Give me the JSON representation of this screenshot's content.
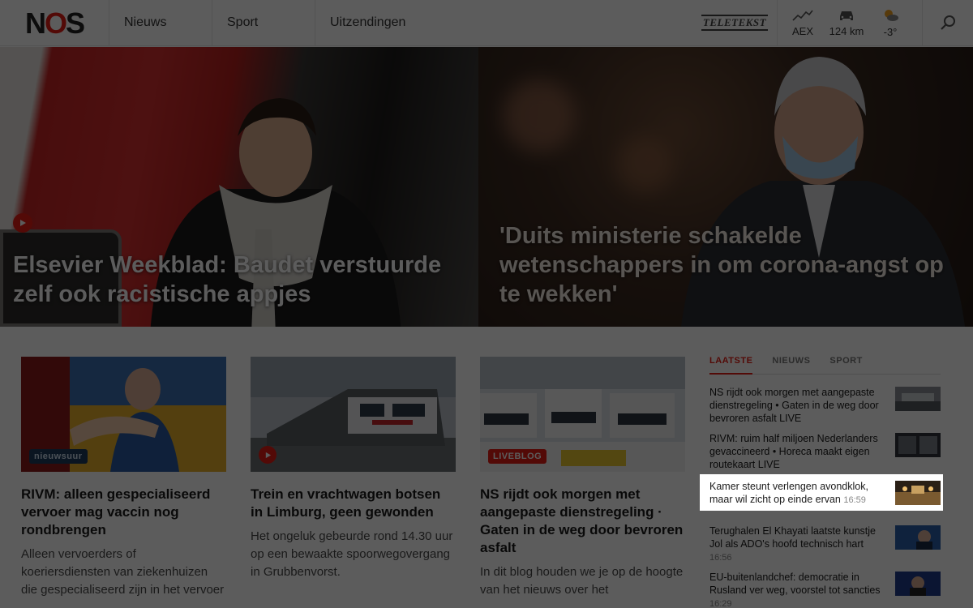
{
  "header": {
    "logo": "NOS",
    "nav": [
      "Nieuws",
      "Sport",
      "Uitzendingen"
    ],
    "teletekst": "TELETEKST",
    "widgets": [
      {
        "icon": "stocks-icon",
        "label": "AEX"
      },
      {
        "icon": "car-icon",
        "label": "124 km"
      },
      {
        "icon": "weather-icon",
        "label": "-3°"
      }
    ]
  },
  "hero": {
    "left_title": "Elsevier Weekblad: Baudet verstuurde zelf ook racistische appjes",
    "right_title": "'Duits ministerie schakelde wetenschappers in om corona-angst op te wekken'"
  },
  "cards": [
    {
      "tag": "nieuwsuur",
      "title": "RIVM: alleen gespecialiseerd vervoer mag vaccin nog rondbrengen",
      "desc": "Alleen vervoerders of koeriersdiensten van ziekenhuizen die gespecialiseerd zijn in het vervoer"
    },
    {
      "tag": "",
      "title": "Trein en vrachtwagen botsen in Limburg, geen gewonden",
      "desc": "Het ongeluk gebeurde rond 14.30 uur op een bewaakte spoorwegovergang in Grubbenvorst."
    },
    {
      "tag": "LIVEBLOG",
      "title": "NS rijdt ook morgen met aangepaste dienstregeling · Gaten in de weg door bevroren asfalt",
      "desc": "In dit blog houden we je op de hoogte van het nieuws over het"
    }
  ],
  "sidebar": {
    "tabs": [
      "LAATSTE",
      "NIEUWS",
      "SPORT"
    ],
    "items": [
      {
        "text": "NS rijdt ook morgen met aangepaste dienstregeling • Gaten in de weg door bevroren asfalt LIVE",
        "time": ""
      },
      {
        "text": "RIVM: ruim half miljoen Nederlanders gevaccineerd • Horeca maakt eigen routekaart LIVE",
        "time": ""
      },
      {
        "text": "Kamer steunt verlengen avondklok, maar wil zicht op einde ervan",
        "time": "16:59"
      },
      {
        "text": "Terughalen El Khayati laatste kunstje Jol als ADO's hoofd technisch hart",
        "time": "16:56"
      },
      {
        "text": "EU-buitenlandchef: democratie in Rusland ver weg, voorstel tot sancties",
        "time": "16:29"
      }
    ]
  },
  "colors": {
    "brand_red": "#e61e14",
    "dim_overlay": "#000000"
  }
}
